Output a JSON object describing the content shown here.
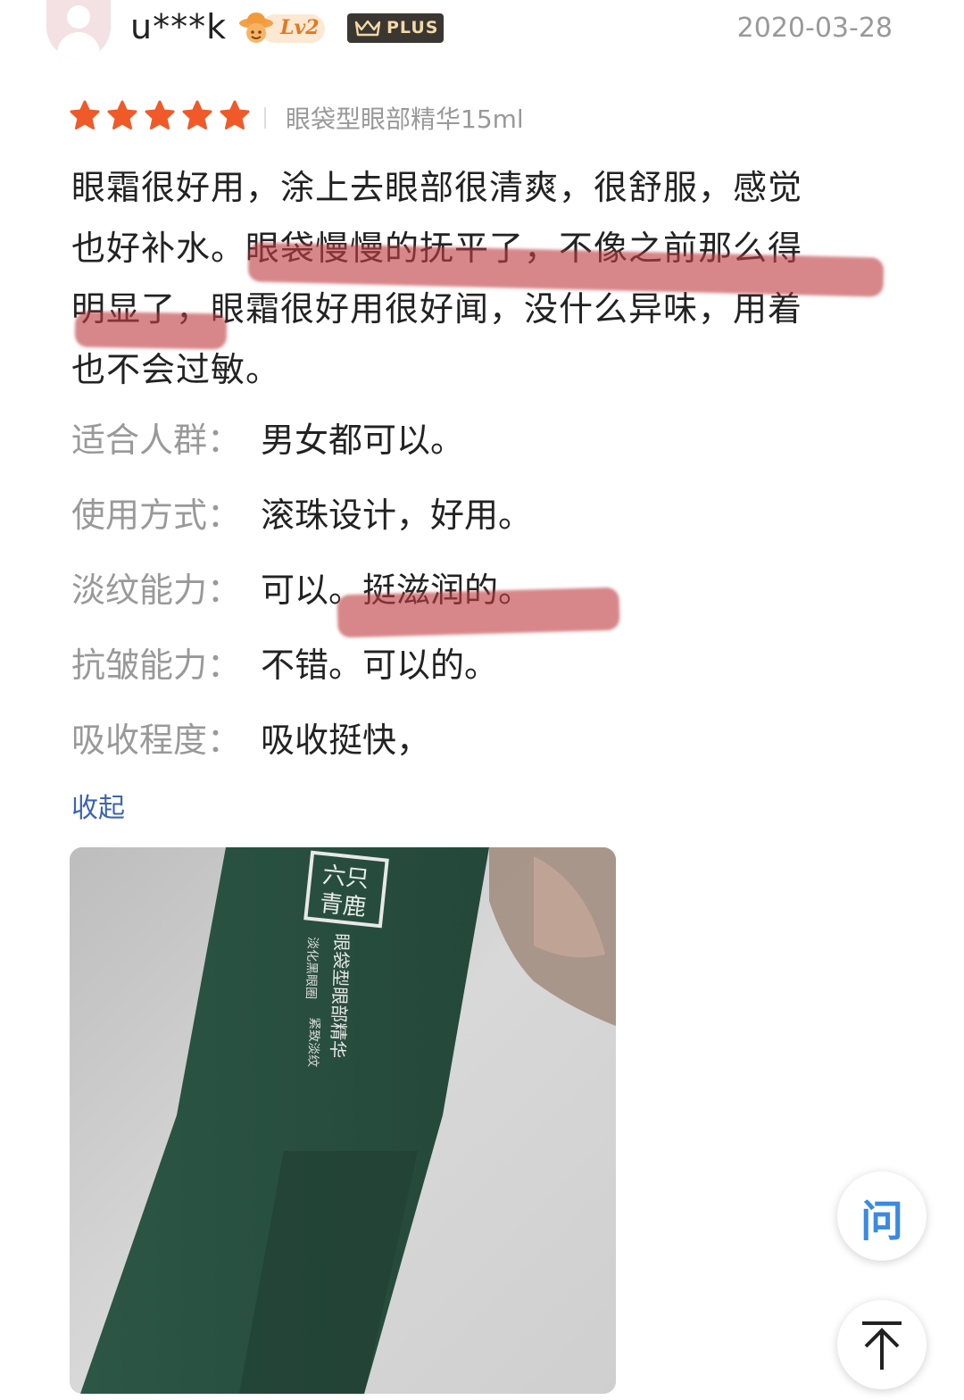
{
  "user": {
    "name": "u***k",
    "level": "Lv2",
    "plus_label": "PLUS"
  },
  "date": "2020-03-28",
  "rating": {
    "stars": 5,
    "max": 5,
    "color": "#f05a28"
  },
  "variant": "眼袋型眼部精华15ml",
  "review_lines": [
    "眼霜很好用，涂上去眼部很清爽，很舒服，感觉",
    "也好补水。眼袋慢慢的抚平了，不像之前那么得",
    "明显了，眼霜很好用很好闻，没什么异味，用着",
    "也不会过敏。"
  ],
  "attributes": [
    {
      "key": "适合人群：",
      "value": "男女都可以。"
    },
    {
      "key": "使用方式：",
      "value": "滚珠设计，好用。"
    },
    {
      "key": "淡纹能力：",
      "value": "可以。挺滋润的。"
    },
    {
      "key": "抗皱能力：",
      "value": "不错。可以的。"
    },
    {
      "key": "吸收程度：",
      "value": "吸收挺快，"
    }
  ],
  "collapse_label": "收起",
  "photo": {
    "box_text_logo": "六只\n青鹿",
    "box_text_main": "眼袋型眼部精华",
    "box_text_sub1": "淡化黑眼圈",
    "box_text_sub2": "紧致淡纹",
    "box_color": "#2f5a4a"
  },
  "float_buttons": {
    "ask_label": "问",
    "top_icon": "arrow-up-to-top-icon"
  },
  "highlight_color": "#be3c41"
}
